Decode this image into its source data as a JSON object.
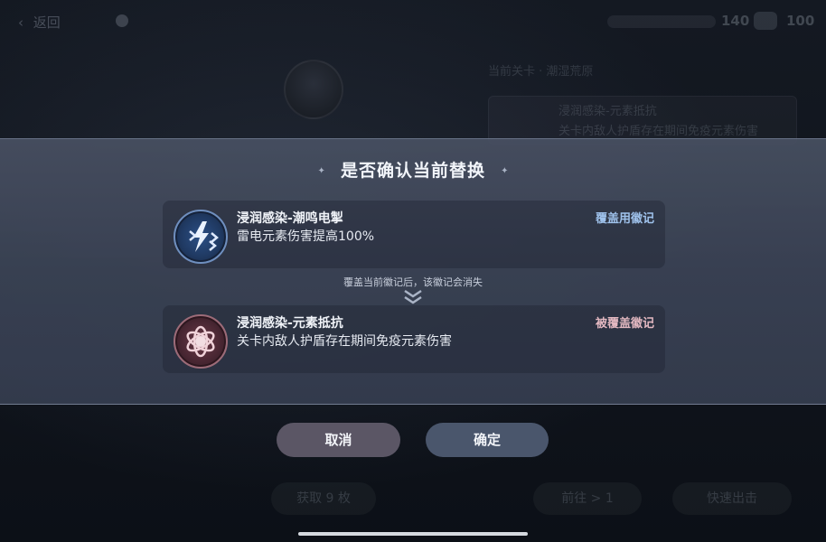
{
  "background": {
    "back_label": "返回",
    "currency_a": "140",
    "currency_b": "100",
    "ghost_texts": [
      "当前关卡 · 潮湿荒原",
      "浸润感染-元素抵抗",
      "关卡内敌人护盾存在期间免疫元素伤害",
      "浸润感染-潮鸣电掣"
    ],
    "bottom_buttons": [
      "获取 9 枚",
      "前往 > 1",
      "快速出击"
    ]
  },
  "modal": {
    "title": "是否确认当前替换",
    "title_deco": "✦",
    "current": {
      "name": "浸润感染-潮鸣电掣",
      "description": "雷电元素伤害提高100%",
      "tag": "覆盖用徽记",
      "icon": "lightning-emblem-icon"
    },
    "hint": "覆盖当前徽记后，该徽记会消失",
    "replaced": {
      "name": "浸润感染-元素抵抗",
      "description": "关卡内敌人护盾存在期间免疫元素伤害",
      "tag": "被覆盖徽记",
      "icon": "shield-atom-emblem-icon"
    }
  },
  "buttons": {
    "cancel": "取消",
    "confirm": "确定"
  },
  "colors": {
    "modal_band": "#485062",
    "cancel_button": "#5b5665",
    "confirm_button": "#4a566c",
    "tag_current": "#9fc2ec",
    "tag_replaced": "#e4b9c2"
  }
}
